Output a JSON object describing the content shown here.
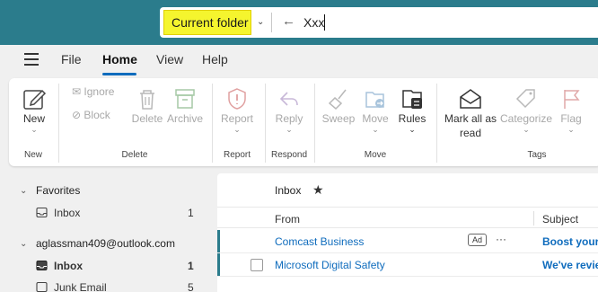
{
  "search": {
    "scope_label": "Current folder",
    "query": "Xxx"
  },
  "menu": {
    "items": [
      "File",
      "Home",
      "View",
      "Help"
    ],
    "active": "Home"
  },
  "ribbon": {
    "new_label": "New",
    "ignore_label": "Ignore",
    "block_label": "Block",
    "delete_label": "Delete",
    "archive_label": "Archive",
    "report_label": "Report",
    "reply_label": "Reply",
    "sweep_label": "Sweep",
    "move_label": "Move",
    "rules_label": "Rules",
    "mark_all_read_line1": "Mark all as",
    "mark_all_read_line2": "read",
    "categorize_label": "Categorize",
    "flag_label": "Flag",
    "groups": {
      "new": "New",
      "delete": "Delete",
      "report": "Report",
      "respond": "Respond",
      "move": "Move",
      "tags": "Tags"
    }
  },
  "nav": {
    "favorites_title": "Favorites",
    "favorites_inbox_label": "Inbox",
    "favorites_inbox_count": "1",
    "account": "aglassman409@outlook.com",
    "account_inbox_label": "Inbox",
    "account_inbox_count": "1",
    "junk_label": "Junk Email",
    "junk_count": "5"
  },
  "list": {
    "folder_title": "Inbox",
    "col_from": "From",
    "col_subject": "Subject",
    "messages": [
      {
        "from": "Comcast Business",
        "badge": "Ad",
        "more": "···",
        "subject": "Boost your I"
      },
      {
        "from": "Microsoft Digital Safety",
        "subject": "We've reviev"
      }
    ]
  },
  "colors": {
    "topbar": "#2b7c8c",
    "accent": "#0f6cbd",
    "highlight": "#f5f52e"
  }
}
